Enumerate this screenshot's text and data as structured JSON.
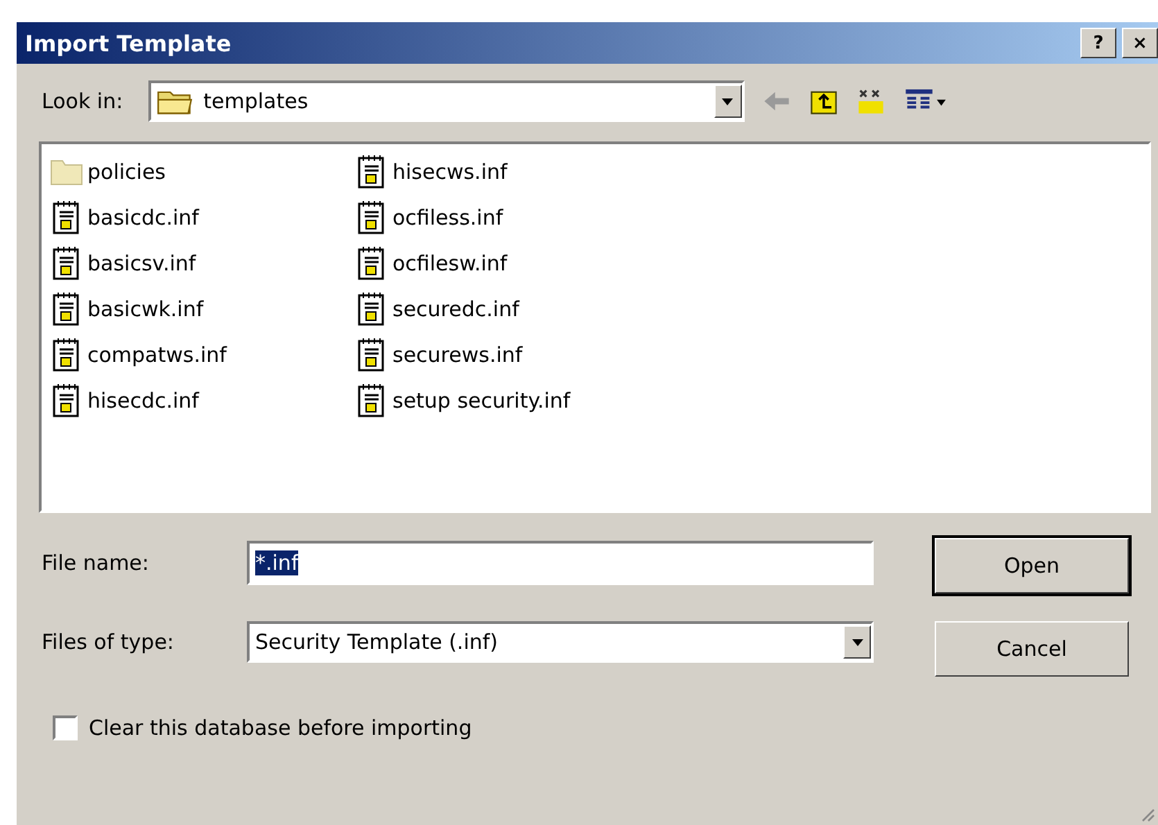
{
  "window": {
    "title": "Import Template",
    "title_buttons": [
      "?",
      "×"
    ]
  },
  "look_in": {
    "label": "Look in:",
    "value": "templates"
  },
  "files": [
    {
      "name": "policies",
      "kind": "folder"
    },
    {
      "name": "basicdc.inf",
      "kind": "file"
    },
    {
      "name": "basicsv.inf",
      "kind": "file"
    },
    {
      "name": "basicwk.inf",
      "kind": "file"
    },
    {
      "name": "compatws.inf",
      "kind": "file"
    },
    {
      "name": "hisecdc.inf",
      "kind": "file"
    },
    {
      "name": "hisecws.inf",
      "kind": "file"
    },
    {
      "name": "ocfiless.inf",
      "kind": "file"
    },
    {
      "name": "ocfilesw.inf",
      "kind": "file"
    },
    {
      "name": "securedc.inf",
      "kind": "file"
    },
    {
      "name": "securews.inf",
      "kind": "file"
    },
    {
      "name": "setup security.inf",
      "kind": "file"
    }
  ],
  "file_name": {
    "label": "File name:",
    "value": "*.inf",
    "value_selected": true
  },
  "file_type": {
    "label": "Files of type:",
    "value": "Security Template (.inf)"
  },
  "buttons": [
    {
      "label": "Open",
      "default": true
    },
    {
      "label": "Cancel",
      "default": false
    }
  ],
  "clear_db": {
    "label": "Clear this database before importing",
    "checked": false
  }
}
